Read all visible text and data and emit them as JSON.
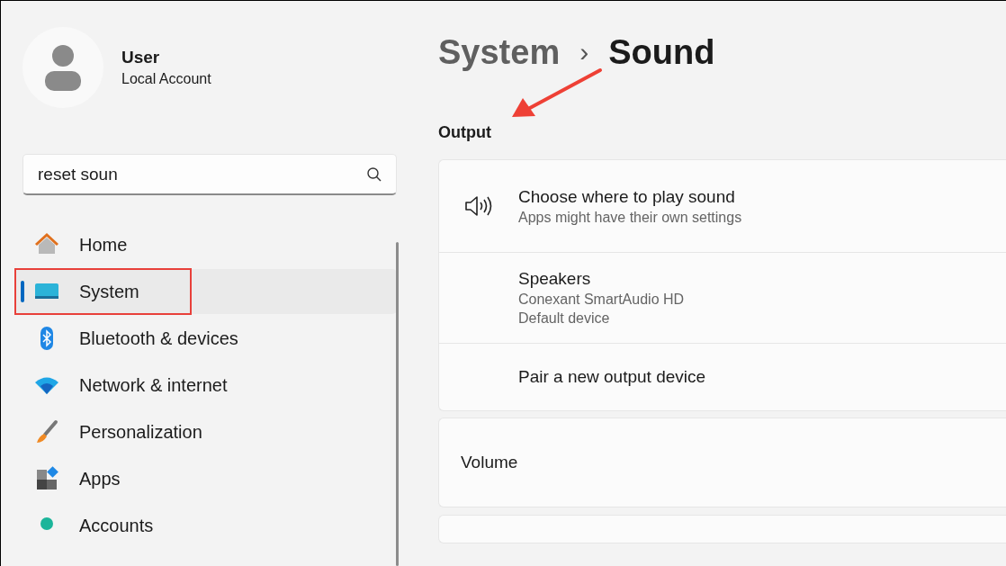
{
  "account": {
    "name": "User",
    "type": "Local Account"
  },
  "search": {
    "value": "reset soun"
  },
  "nav": [
    {
      "label": "Home",
      "selected": false
    },
    {
      "label": "System",
      "selected": true
    },
    {
      "label": "Bluetooth & devices",
      "selected": false
    },
    {
      "label": "Network & internet",
      "selected": false
    },
    {
      "label": "Personalization",
      "selected": false
    },
    {
      "label": "Apps",
      "selected": false
    },
    {
      "label": "Accounts",
      "selected": false
    }
  ],
  "breadcrumb": {
    "parent": "System",
    "separator": "›",
    "current": "Sound"
  },
  "section": "Output",
  "output_rows": [
    {
      "title": "Choose where to play sound",
      "lines": [
        "Apps might have their own settings"
      ]
    },
    {
      "title": "Speakers",
      "lines": [
        "Conexant SmartAudio HD",
        "Default device"
      ]
    },
    {
      "title": "Pair a new output device",
      "lines": []
    }
  ],
  "volume": {
    "label": "Volume"
  }
}
